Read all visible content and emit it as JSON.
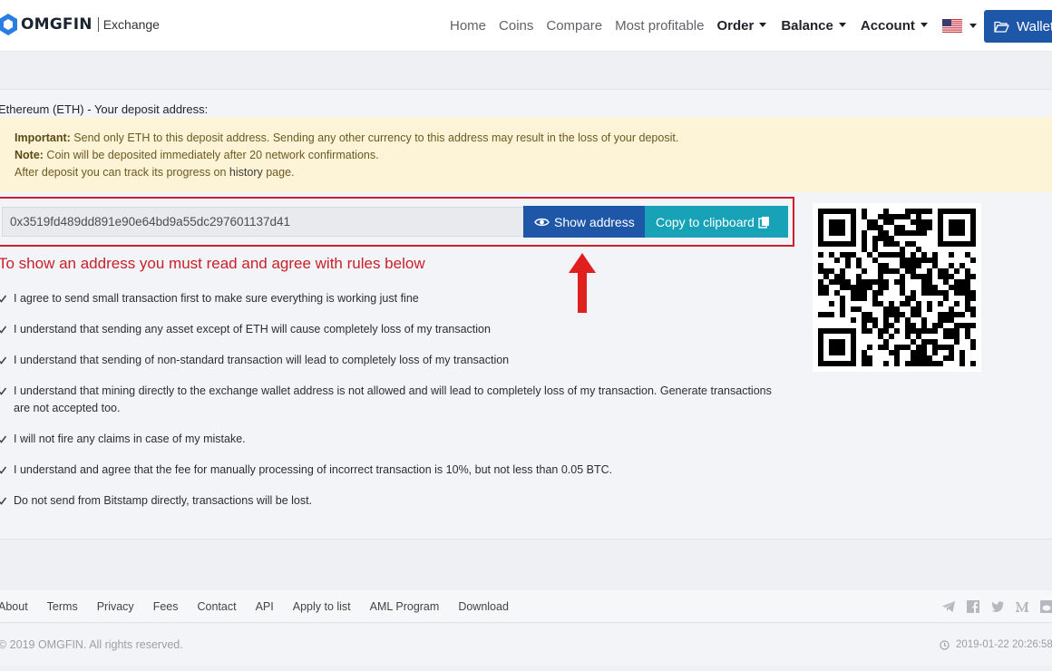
{
  "brand": {
    "name": "OMGFIN",
    "sub": "Exchange"
  },
  "nav": {
    "links": [
      "Home",
      "Coins",
      "Compare",
      "Most profitable"
    ],
    "dropdowns": [
      "Order",
      "Balance",
      "Account"
    ],
    "wallet": "Wallet"
  },
  "deposit": {
    "title": "Ethereum (ETH) - Your deposit address:",
    "alert": {
      "important_label": "Important:",
      "important_text": " Send only ETH to this deposit address. Sending any other currency to this address may result in the loss of your deposit.",
      "note_label": "Note:",
      "note_text": " Coin will be deposited immediately after 20 network confirmations.",
      "track_prefix": "After deposit you can track its progress on ",
      "track_link": "history",
      "track_suffix": " page."
    },
    "address": "0x3519fd489dd891e90e64bd9a55dc297601137d41",
    "show_button": "Show address",
    "copy_button": "Copy to clipboard",
    "warning": "To show an address you must read and agree with rules below",
    "rules": [
      "I agree to send small transaction first to make sure everything is working just fine",
      "I understand that sending any asset except of ETH will cause completely loss of my transaction",
      "I understand that sending of non-standard transaction will lead to completely loss of my transaction",
      "I understand that mining directly to the exchange wallet address is not allowed and will lead to completely loss of my transaction. Generate transactions are not accepted too.",
      "I will not fire any claims in case of my mistake.",
      "I understand and agree that the fee for manually processing of incorrect transaction is 10%, but not less than 0.05 BTC.",
      "Do not send from Bitstamp directly, transactions will be lost."
    ]
  },
  "footer": {
    "links": [
      "About",
      "Terms",
      "Privacy",
      "Fees",
      "Contact",
      "API",
      "Apply to list",
      "AML Program",
      "Download"
    ],
    "social": [
      "telegram-icon",
      "facebook-icon",
      "twitter-icon",
      "medium-icon",
      "reddit-icon"
    ],
    "copyright": "© 2019 OMGFIN. All rights reserved.",
    "server_time": "2019-01-22 20:26:58"
  },
  "colors": {
    "primary": "#1f57a8",
    "info": "#17a2b8",
    "danger": "#c9202a",
    "alert_bg": "#fdf3d6"
  }
}
